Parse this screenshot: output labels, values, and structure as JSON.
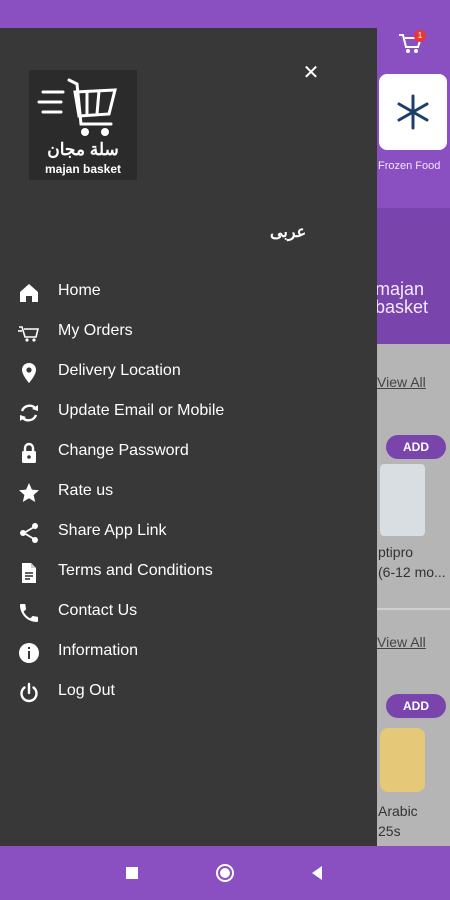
{
  "drawer": {
    "logo_text_ar": "سلة مجان",
    "logo_text_en": "majan basket",
    "language_toggle": "عربى",
    "menu_items": [
      {
        "label": "Home",
        "icon": "home-icon"
      },
      {
        "label": "My Orders",
        "icon": "cart-icon"
      },
      {
        "label": "Delivery Location",
        "icon": "location-pin-icon"
      },
      {
        "label": "Update Email or Mobile",
        "icon": "sync-icon"
      },
      {
        "label": "Change Password",
        "icon": "lock-icon"
      },
      {
        "label": "Rate us",
        "icon": "star-icon"
      },
      {
        "label": "Share App Link",
        "icon": "share-icon"
      },
      {
        "label": "Terms and Conditions",
        "icon": "document-icon"
      },
      {
        "label": "Contact Us",
        "icon": "phone-icon"
      },
      {
        "label": "Information",
        "icon": "info-icon"
      },
      {
        "label": "Log Out",
        "icon": "power-icon"
      }
    ]
  },
  "background": {
    "cart_badge": "1",
    "category_label": "Frozen Food",
    "banner_text": "majan basket",
    "view_all_1": "View All",
    "view_all_2": "View All",
    "add_label": "ADD",
    "product_1_line1": "ptipro",
    "product_1_line2": "(6-12 mo...",
    "product_2_line1": "Arabic",
    "product_2_line2": "25s"
  },
  "colors": {
    "primary": "#8a4fc0",
    "drawer_bg": "#383838"
  }
}
